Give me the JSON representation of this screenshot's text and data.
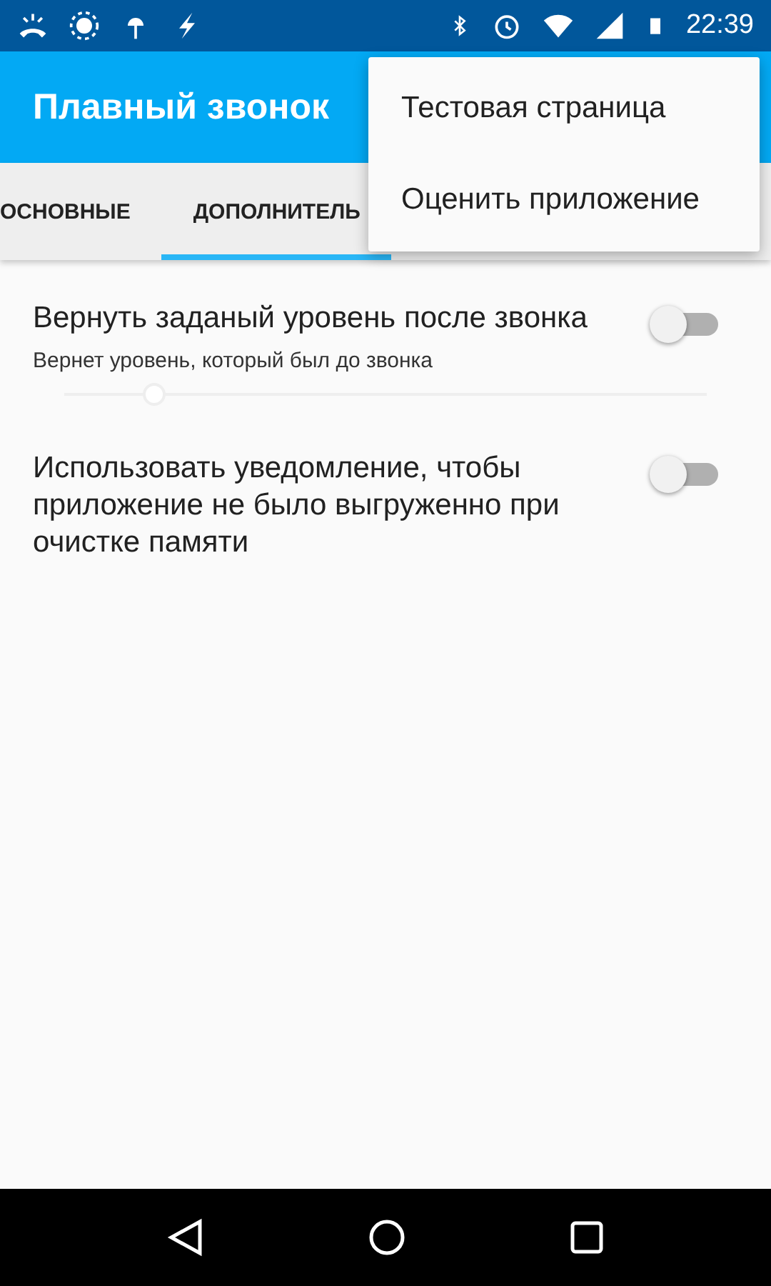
{
  "status_bar": {
    "time": "22:39"
  },
  "app_bar": {
    "title": "Плавный звонок"
  },
  "tabs": [
    {
      "label": "ОСНОВНЫЕ",
      "selected": false
    },
    {
      "label": "ДОПОЛНИТЕЛЬ",
      "selected": true
    }
  ],
  "settings": [
    {
      "kind": "switch",
      "title": "Вернуть заданый уровень после звонка",
      "summary": "Вернет уровень, который был до звонка",
      "on": false
    },
    {
      "kind": "slider",
      "level": 0.14
    },
    {
      "kind": "switch",
      "title": "Использовать уведомление, чтобы приложение не было выгруженно при очистке памяти",
      "on": false
    }
  ],
  "menu": {
    "items": [
      "Тестовая страница",
      "Оценить приложение"
    ]
  }
}
